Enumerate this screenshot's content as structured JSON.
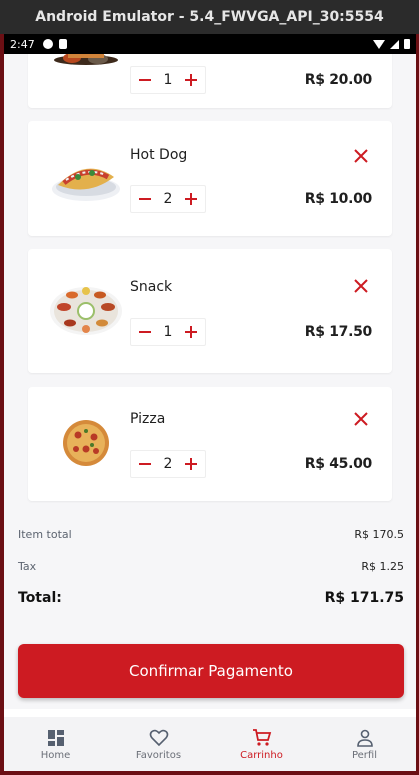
{
  "window": {
    "title": "Android Emulator - 5.4_FWVGA_API_30:5554"
  },
  "status_bar": {
    "time": "2:47"
  },
  "cart": {
    "items": [
      {
        "name": "",
        "quantity": "1",
        "price": "R$ 20.00",
        "image": "burger-icon"
      },
      {
        "name": "Hot Dog",
        "quantity": "2",
        "price": "R$ 10.00",
        "image": "hotdog-icon"
      },
      {
        "name": "Snack",
        "quantity": "1",
        "price": "R$ 17.50",
        "image": "snack-platter-icon"
      },
      {
        "name": "Pizza",
        "quantity": "2",
        "price": "R$ 45.00",
        "image": "pizza-icon"
      }
    ]
  },
  "summary": {
    "item_total_label": "Item total",
    "item_total_value": "R$ 170.5",
    "tax_label": "Tax",
    "tax_value": "R$ 1.25",
    "total_label": "Total:",
    "total_value": "R$ 171.75"
  },
  "confirm_button": {
    "label": "Confirmar Pagamento"
  },
  "bottom_nav": {
    "items": [
      {
        "label": "Home",
        "icon": "grid-icon",
        "active": false
      },
      {
        "label": "Favoritos",
        "icon": "heart-icon",
        "active": false
      },
      {
        "label": "Carrinho",
        "icon": "cart-icon",
        "active": true
      },
      {
        "label": "Perfil",
        "icon": "person-icon",
        "active": false
      }
    ]
  },
  "colors": {
    "accent": "#cd1b22",
    "background": "#f6f6f8",
    "card": "#ffffff",
    "text": "#1f1f1f",
    "muted": "#5c6470"
  }
}
